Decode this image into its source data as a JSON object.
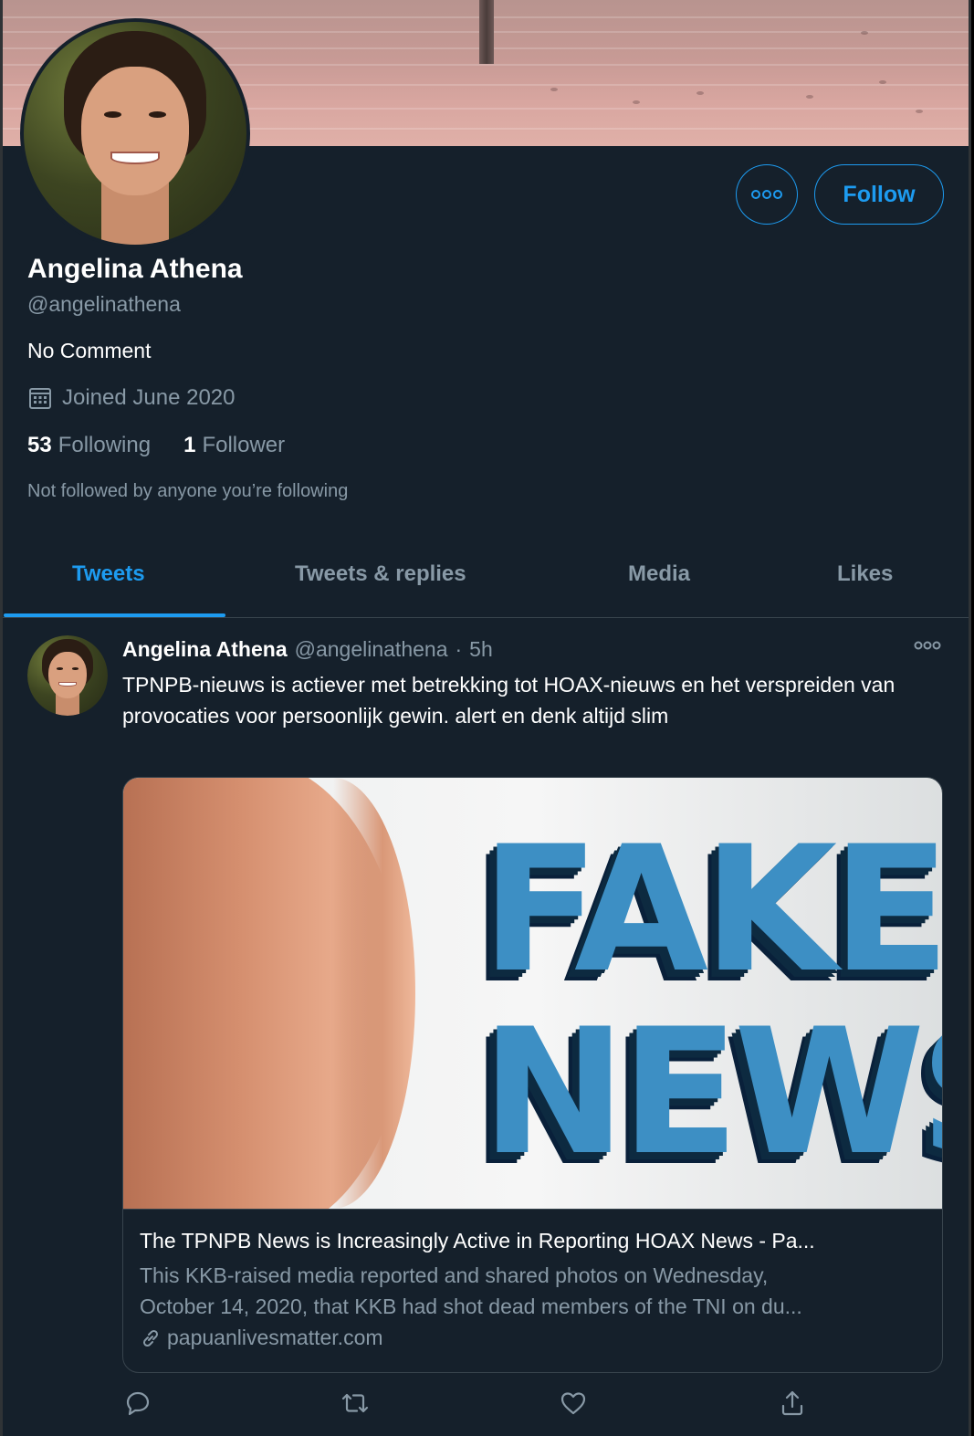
{
  "profile": {
    "name": "Angelina Athena",
    "handle": "@angelinathena",
    "bio": "No Comment",
    "joined": "Joined June 2020",
    "following_count": "53",
    "following_label": "Following",
    "followers_count": "1",
    "followers_label": "Follower",
    "not_followed_note": "Not followed by anyone you’re following"
  },
  "buttons": {
    "follow_label": "Follow"
  },
  "tabs": [
    {
      "label": "Tweets",
      "active": true
    },
    {
      "label": "Tweets & replies",
      "active": false
    },
    {
      "label": "Media",
      "active": false
    },
    {
      "label": "Likes",
      "active": false
    }
  ],
  "tweet": {
    "author_name": "Angelina Athena",
    "author_handle": "@angelinathena",
    "separator": "·",
    "time": "5h",
    "text": "TPNPB-nieuws is actiever met betrekking tot HOAX-nieuws en het verspreiden van provocaties voor persoonlijk gewin. alert en denk altijd slim",
    "card": {
      "image_text_line1": "FAKE",
      "image_text_line2": "NEWS",
      "title": "The TPNPB News is Increasingly Active in Reporting HOAX News - Pa...",
      "description_line1": "This KKB-raised media reported and shared photos on Wednesday,",
      "description_line2": "October 14, 2020, that KKB had shot dead members of the TNI on du...",
      "domain": "papuanlivesmatter.com"
    },
    "actions": [
      "reply-icon",
      "retweet-icon",
      "like-icon",
      "share-icon"
    ]
  },
  "colors": {
    "background": "#15202b",
    "accent": "#1d9bf0",
    "secondary_text": "#8899a6",
    "border": "#38444d"
  }
}
